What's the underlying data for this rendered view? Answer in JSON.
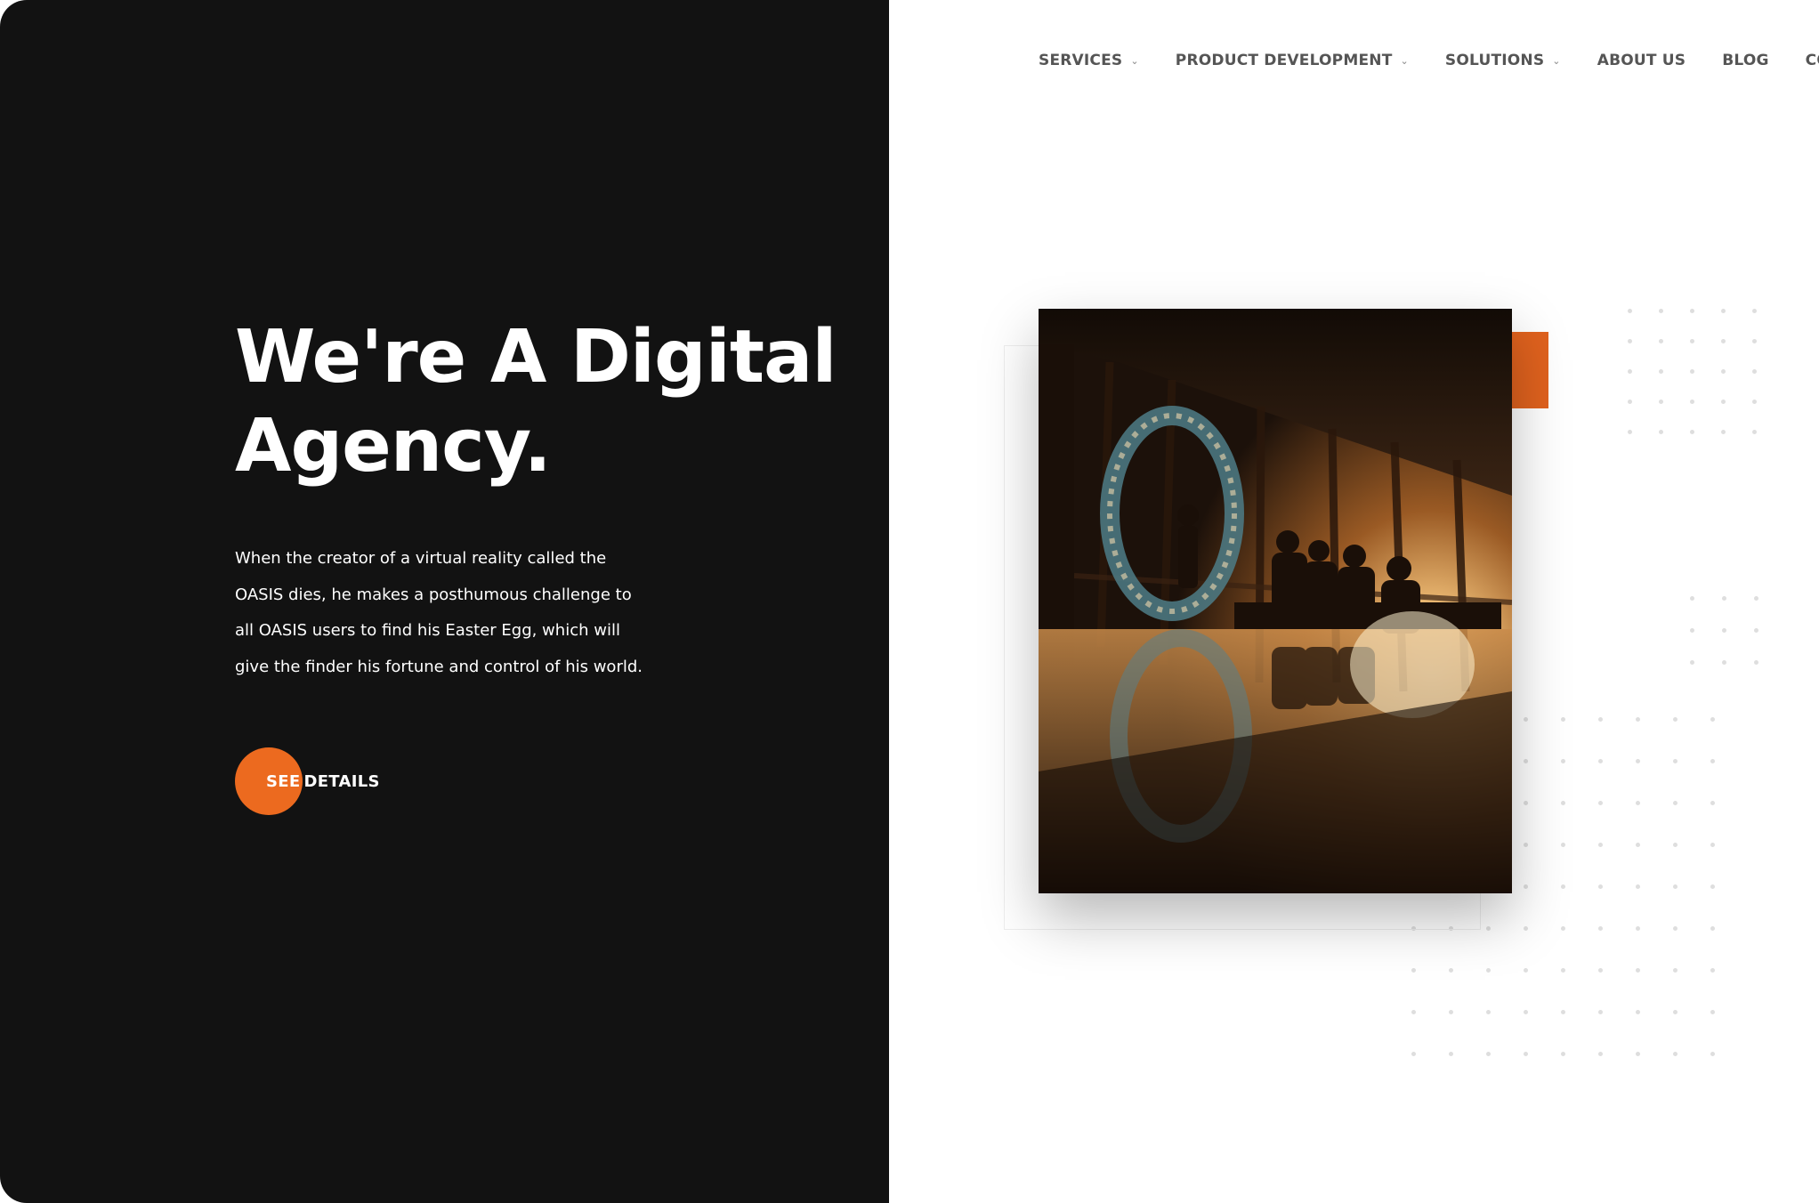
{
  "hero": {
    "title_lines": [
      "We're A Digital",
      "Agency."
    ],
    "description_lines": [
      "When the creator of a virtual reality called the",
      "OASIS dies, he makes a posthumous challenge to",
      "all OASIS users to find his Easter Egg, which will",
      "give the finder his fortune and control of his world."
    ],
    "cta_word1": "SEE",
    "cta_word2": "DETAILS"
  },
  "nav": {
    "items": [
      {
        "label": "SERVICES",
        "has_dropdown": true
      },
      {
        "label": "PRODUCT DEVELOPMENT",
        "has_dropdown": true
      },
      {
        "label": "SOLUTIONS",
        "has_dropdown": true
      },
      {
        "label": "ABOUT US",
        "has_dropdown": false
      },
      {
        "label": "BLOG",
        "has_dropdown": false
      },
      {
        "label": "CO",
        "has_dropdown": false
      }
    ],
    "dropdown_icon": "chevron-down-icon"
  },
  "colors": {
    "dark_panel": "#121212",
    "accent": "#ec6a1f",
    "nav_text": "#555555",
    "dot_grid": "#dedede"
  }
}
